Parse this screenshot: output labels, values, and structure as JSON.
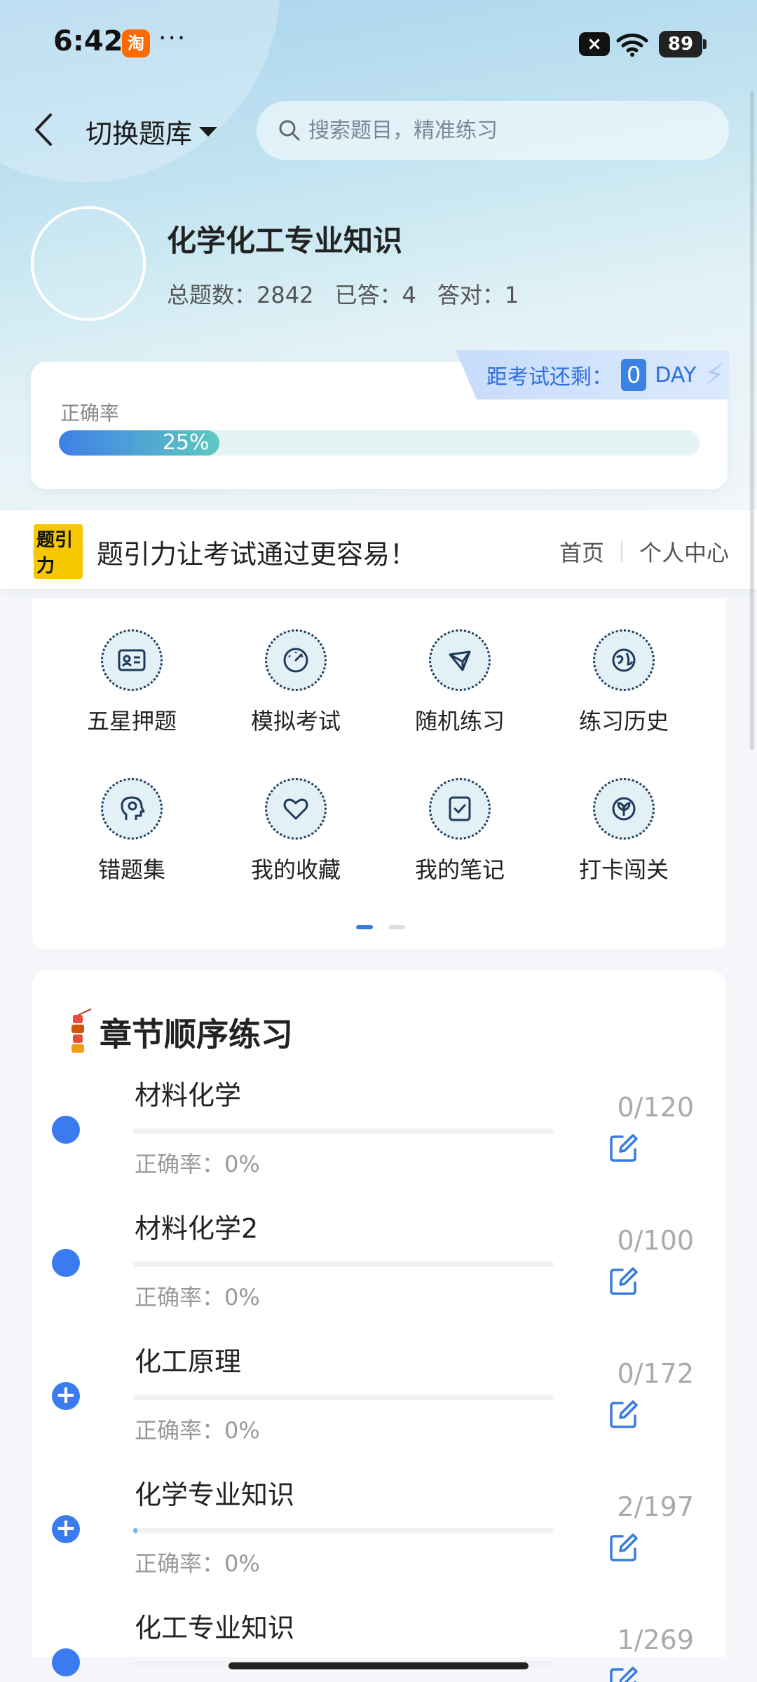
{
  "status_bar": {
    "time": "6:42",
    "app_badge": "淘",
    "overflow": "···",
    "battery": "89"
  },
  "header": {
    "switch_label": "切换题库",
    "search_placeholder": "搜索题目，精准练习"
  },
  "bank": {
    "title": "化学化工专业知识",
    "total_label": "总题数：",
    "total": "2842",
    "answered_label": "已答：",
    "answered": "4",
    "correct_label": "答对：",
    "correct": "1"
  },
  "countdown": {
    "label": "距考试还剩：",
    "days": "0",
    "unit": "DAY"
  },
  "accuracy": {
    "label": "正确率",
    "percent_text": "25%",
    "percent": 25
  },
  "brand": {
    "logo_text": "题引力",
    "slogan": "题引力让考试通过更容易！",
    "nav_home": "首页",
    "nav_profile": "个人中心"
  },
  "menu": [
    {
      "label": "五星押题",
      "icon": "id-card-icon"
    },
    {
      "label": "模拟考试",
      "icon": "gauge-icon"
    },
    {
      "label": "随机练习",
      "icon": "network-icon"
    },
    {
      "label": "练习历史",
      "icon": "globe-icon"
    },
    {
      "label": "错题集",
      "icon": "head-icon"
    },
    {
      "label": "我的收藏",
      "icon": "heart-icon"
    },
    {
      "label": "我的笔记",
      "icon": "note-check-icon"
    },
    {
      "label": "打卡闯关",
      "icon": "leaf-icon"
    }
  ],
  "chapters": {
    "title": "章节顺序练习",
    "items": [
      {
        "name": "材料化学",
        "accuracy": "正确率：0%",
        "count": "0/120",
        "progress": 0,
        "marker": ""
      },
      {
        "name": "材料化学2",
        "accuracy": "正确率：0%",
        "count": "0/100",
        "progress": 0,
        "marker": ""
      },
      {
        "name": "化工原理",
        "accuracy": "正确率：0%",
        "count": "0/172",
        "progress": 0,
        "marker": "+"
      },
      {
        "name": "化学专业知识",
        "accuracy": "正确率：0%",
        "count": "2/197",
        "progress": 1,
        "marker": "+"
      },
      {
        "name": "化工专业知识",
        "accuracy": "",
        "count": "1/269",
        "progress": 0,
        "marker": ""
      }
    ]
  }
}
